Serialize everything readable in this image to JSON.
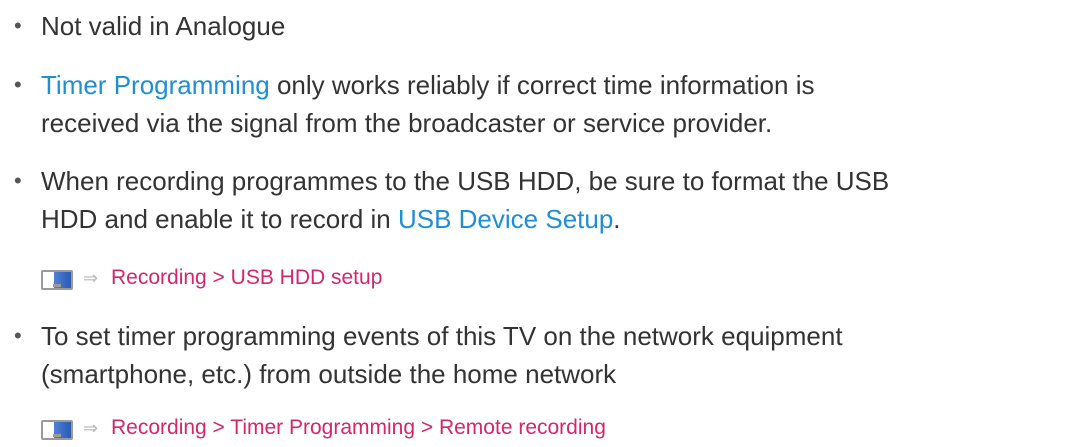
{
  "items": [
    {
      "bullet": "•",
      "text": "Not valid in Analogue"
    },
    {
      "bullet": "•",
      "link": "Timer Programming",
      "text_after": " only works reliably if correct time information is",
      "line2": "received via the signal from the broadcaster or service provider."
    },
    {
      "bullet": "•",
      "text": "When recording programmes to the USB HDD, be sure to format the USB",
      "line2_before": "HDD and enable it to record in ",
      "link": "USB Device Setup",
      "line2_after": "."
    },
    {
      "bullet": "•",
      "text": "To set timer programming events of this TV on the network equipment",
      "line2": "(smartphone, etc.) from outside the home network"
    }
  ],
  "refs": [
    {
      "icon": "tv-menu-icon",
      "arrow": "⇒",
      "path": "Recording > USB HDD setup"
    },
    {
      "icon": "tv-menu-icon",
      "arrow": "⇒",
      "path": "Recording > Timer Programming > Remote recording"
    }
  ],
  "colors": {
    "body_text": "#333333",
    "link": "#1e8fd6",
    "ref_path": "#d3266d"
  }
}
